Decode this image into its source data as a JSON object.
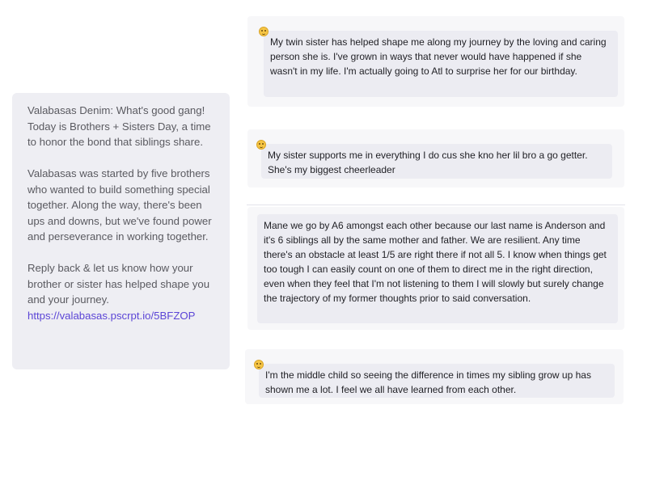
{
  "outgoing_message": {
    "paragraph_1": "Valabasas Denim: What's good gang! Today is Brothers + Sisters Day, a time to honor the bond that siblings share.",
    "paragraph_2": "Valabasas was started by five brothers who wanted to build something special together. Along the way, there's been ups and downs, but we've found power and perseverance in working together.",
    "paragraph_3": "Reply back & let us know how your brother or sister has helped shape you and your journey.",
    "link": "https://valabasas.pscrpt.io/5BFZOP"
  },
  "replies": [
    {
      "text": "My twin sister has helped shape me along my journey by the loving and caring person she is. I've grown in ways that never would have happened if she wasn't in my life. I'm actually going to Atl to surprise her for our birthday.",
      "icon": "smile-emoji-icon"
    },
    {
      "text": "My sister supports me in everything I do cus she kno her lil bro a go getter.  She's my biggest cheerleader",
      "icon": "smile-emoji-icon"
    },
    {
      "text": "Mane we go by A6 amongst each other because our last name is Anderson and it's 6 siblings all by the same mother and father. We are resilient. Any time there's an obstacle at least 1/5 are right there if not all 5. I know when things get too tough I can easily count on one of them to direct me in the right direction, even when they feel that I'm not listening to them I will slowly but surely change the trajectory of my former thoughts prior to said conversation.",
      "icon": ""
    },
    {
      "text": "I'm the middle child so seeing the difference in times my sibling grow up has shown me a lot. I feel we all have learned from each other.",
      "icon": "smile-emoji-icon"
    }
  ],
  "colors": {
    "outgoing_bg": "#eeeef3",
    "reply_bg": "#ececf2",
    "card_bg": "#f7f7f9",
    "link": "#5b45d6"
  }
}
